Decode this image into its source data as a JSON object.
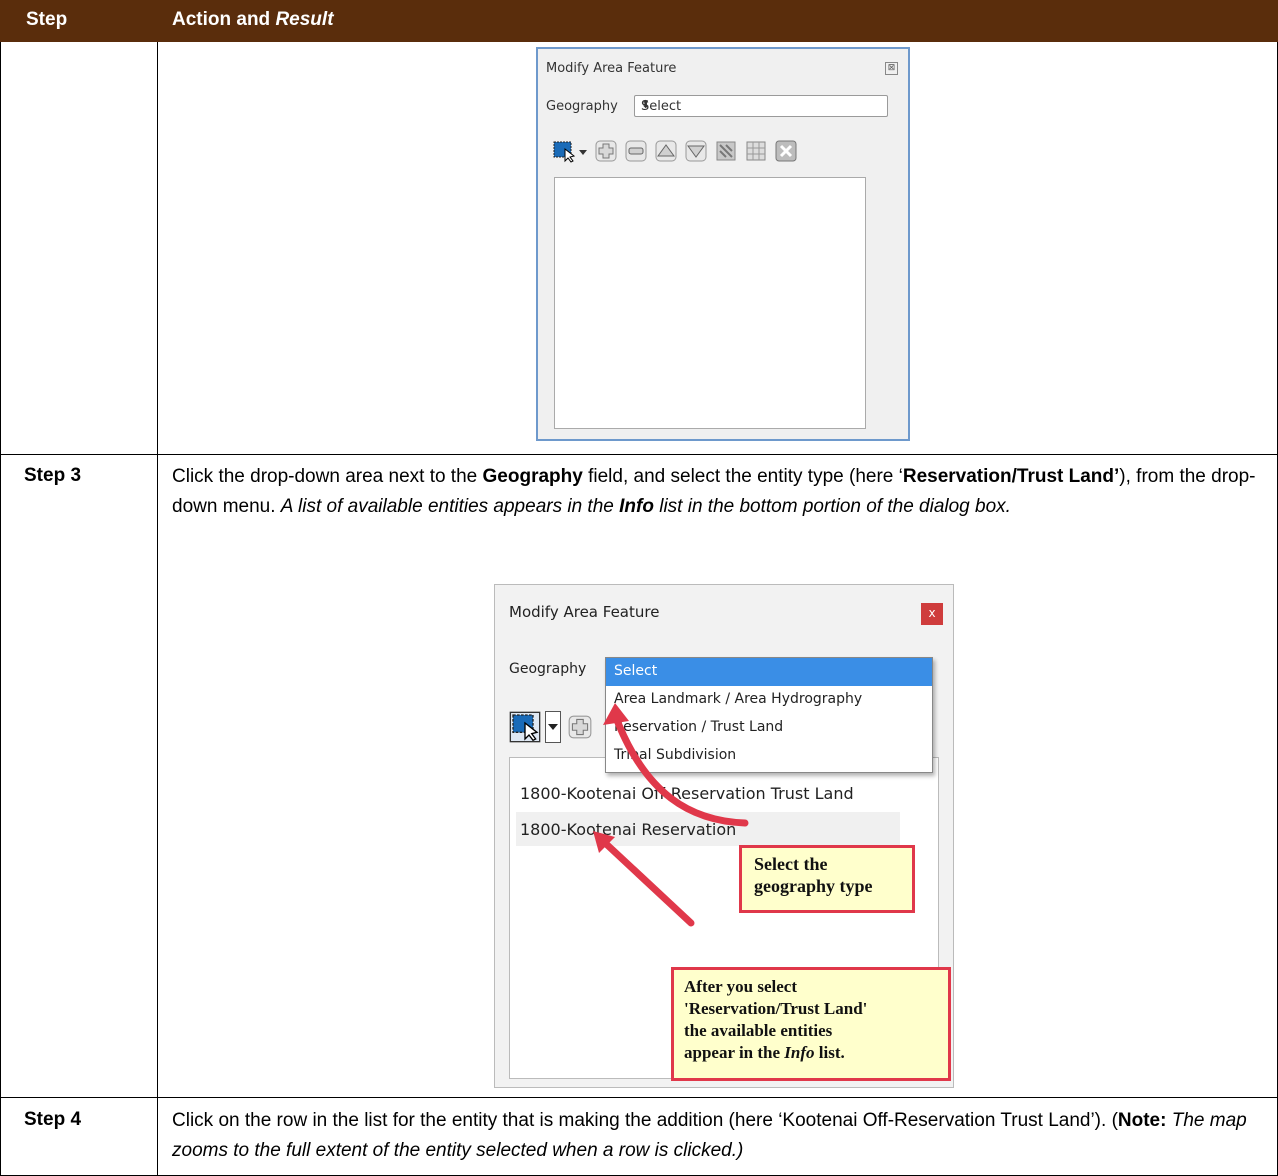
{
  "header": {
    "col1": "Step",
    "col2_prefix": "Action and ",
    "col2_italic": "Result"
  },
  "dialog1": {
    "title": "Modify Area Feature",
    "close_glyph": "⊠",
    "geography_label": "Geography",
    "geography_value": "Select",
    "select_arrow": "⬍"
  },
  "step3": {
    "label": "Step 3",
    "text_1": "Click the drop-down area next to the ",
    "bold_1": "Geography",
    "text_2": " field, and select the entity type (here ‘",
    "bold_2": "Reservation/Trust Land’",
    "text_3": "), from the drop-down menu. ",
    "italic_1": "A list of available entities appears in the ",
    "bold_italic": "Info",
    "italic_2": " list in the bottom portion of the dialog box."
  },
  "dialog2": {
    "title": "Modify Area Feature",
    "close_glyph": "x",
    "geography_label": "Geography",
    "options": [
      "Select",
      "Area Landmark / Area Hydrography",
      "Reservation / Trust Land",
      "Tribal Subdivision"
    ],
    "list_rows": [
      "1800-Kootenai Off-Reservation Trust Land",
      "1800-Kootenai Reservation"
    ],
    "callout1": [
      "Select the",
      "geography type"
    ],
    "callout2_line1": "After you select",
    "callout2_line2": "'Reservation/Trust Land'",
    "callout2_line3": "the available entities",
    "callout2_line4_a": "appear in the ",
    "callout2_line4_i": "Info",
    "callout2_line4_b": " list."
  },
  "step4": {
    "label": "Step 4",
    "text_1": "Click on the row in the list for the entity that is making the addition (here ‘Kootenai Off-Reservation Trust Land’). (",
    "bold_1": "Note:",
    "italic_1": " The map zooms to the full extent of the entity selected when a row is clicked.)"
  }
}
